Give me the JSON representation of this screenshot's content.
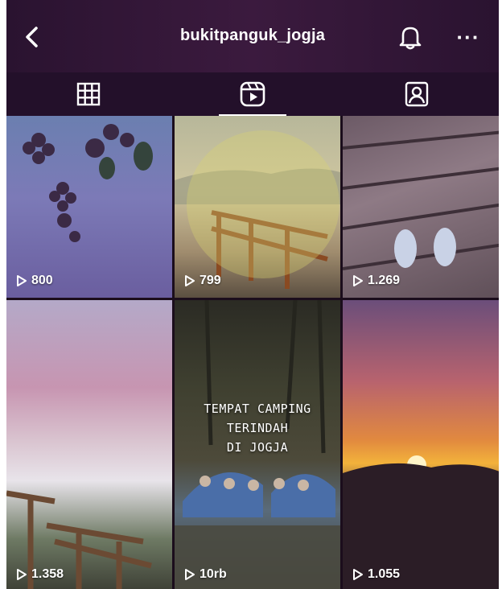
{
  "header": {
    "username": "bukitpanguk_jogja"
  },
  "tabs": [
    {
      "icon": "grid-icon",
      "active": false
    },
    {
      "icon": "reels-icon",
      "active": true
    },
    {
      "icon": "tagged-icon",
      "active": false
    }
  ],
  "reels": [
    {
      "views": "800"
    },
    {
      "views": "799"
    },
    {
      "views": "1.269"
    },
    {
      "views": "1.358"
    },
    {
      "views": "10rb",
      "overlay": [
        "TEMPAT CAMPING",
        "TERINDAH",
        "DI JOGJA"
      ]
    },
    {
      "views": "1.055"
    }
  ],
  "colors": {
    "header_bg": "#2a1330",
    "text": "#ffffff"
  }
}
